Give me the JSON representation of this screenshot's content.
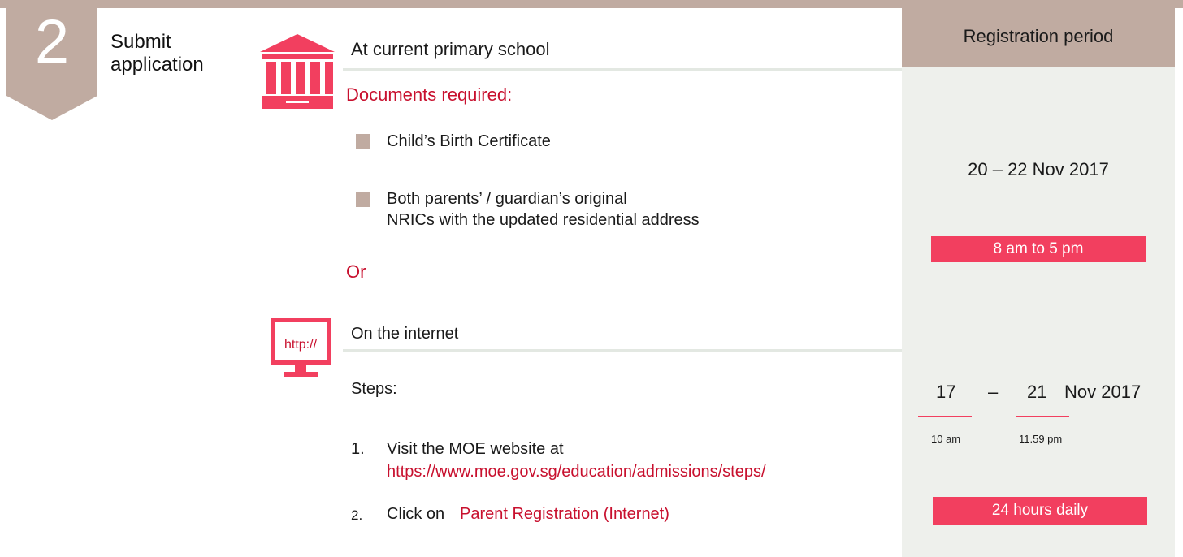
{
  "step": {
    "number": "2",
    "title_line1": "Submit",
    "title_line2": "application"
  },
  "school_section": {
    "heading": "At current primary school",
    "docs_heading": "Documents required:",
    "documents": [
      {
        "lines": [
          "Child’s Birth Certificate"
        ]
      },
      {
        "lines": [
          "Both parents’ / guardian’s original",
          "NRICs with the updated residential address"
        ]
      }
    ],
    "or_label": "Or"
  },
  "internet_section": {
    "icon_text": "http://",
    "heading": "On the internet",
    "steps_heading": "Steps:",
    "steps": [
      {
        "number": "1.",
        "text": "Visit the MOE website at",
        "link": "https://www.moe.gov.sg/education/admissions/steps/"
      },
      {
        "number": "2.",
        "text": "Click on",
        "link": "Parent Registration (Internet)"
      }
    ]
  },
  "registration": {
    "header": "Registration period",
    "school_period": "20 – 22 Nov 2017",
    "school_hours": "8 am to 5 pm",
    "internet_start_day": "17",
    "internet_dash": "–",
    "internet_end_day": "21",
    "internet_month_year": "Nov 2017",
    "internet_start_time": "10 am",
    "internet_end_time": "11.59 pm",
    "internet_hours": "24 hours daily"
  },
  "colors": {
    "accent_red": "#f23f5f",
    "text_red": "#c8102e",
    "taupe": "#c0aba1",
    "panel_grey": "#eef0ec"
  }
}
